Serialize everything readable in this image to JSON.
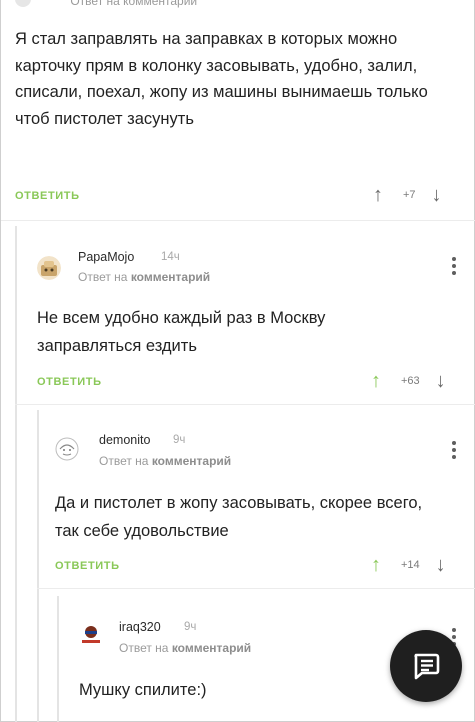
{
  "top": {
    "meta": "Ответ на комментарий"
  },
  "comment1": {
    "text": "Я стал заправлять на заправках в которых можно карточку прям в колонку засовывать, удобно, залил, списали, поехал, жопу из машины вынимаешь только чтоб пистолет засунуть",
    "reply_label": "ОТВЕТИТЬ",
    "rating": "+7"
  },
  "comment2": {
    "author": "PapaMojo",
    "time": "14ч",
    "meta_prefix": "Ответ на",
    "meta_link": "комментарий",
    "text": "Не всем удобно каждый раз в Москву заправляться ездить",
    "reply_label": "ОТВЕТИТЬ",
    "rating": "+63",
    "upvoted": true
  },
  "comment3": {
    "author": "demonito",
    "time": "9ч",
    "meta_prefix": "Ответ на",
    "meta_link": "комментарий",
    "text": "Да и пистолет в жопу засовывать, скорее всего, так себе удовольствие",
    "reply_label": "ОТВЕТИТЬ",
    "rating": "+14",
    "upvoted": true
  },
  "comment4": {
    "author": "iraq320",
    "time": "9ч",
    "meta_prefix": "Ответ на",
    "meta_link": "комментарий",
    "text": "Мушку спилите:)"
  },
  "colors": {
    "accent": "#8ac858",
    "text": "#222222",
    "muted": "#9a9a9a",
    "fab": "#1f1f1f"
  },
  "icons": {
    "up": "arrow-up-icon",
    "down": "arrow-down-icon",
    "menu": "more-vertical-icon",
    "fab": "comment-icon"
  }
}
